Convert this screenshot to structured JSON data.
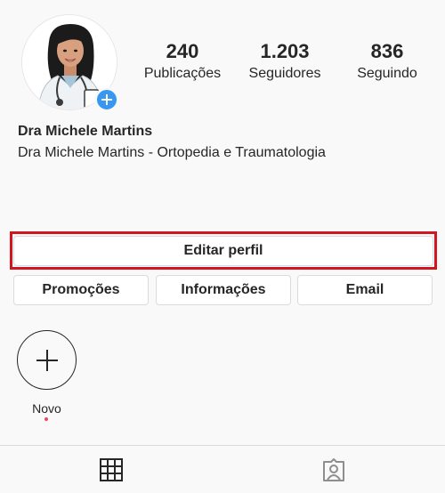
{
  "profile": {
    "display_name": "Dra Michele Martins",
    "bio": "Dra Michele Martins - Ortopedia e Traumatologia",
    "avatar_icon": "doctor-illustration-avatar",
    "add_icon": "plus-badge-icon"
  },
  "stats": [
    {
      "value": "240",
      "label": "Publicações"
    },
    {
      "value": "1.203",
      "label": "Seguidores"
    },
    {
      "value": "836",
      "label": "Seguindo"
    }
  ],
  "actions": {
    "edit_profile": "Editar perfil",
    "promotions": "Promoções",
    "info": "Informações",
    "email": "Email"
  },
  "highlights": {
    "new_label": "Novo"
  },
  "tabs": {
    "grid_icon": "grid-icon",
    "tagged_icon": "tagged-user-icon"
  },
  "colors": {
    "accent_blue": "#3897f0",
    "highlight_red": "#d0161e",
    "notification_dot": "#ed4956"
  }
}
